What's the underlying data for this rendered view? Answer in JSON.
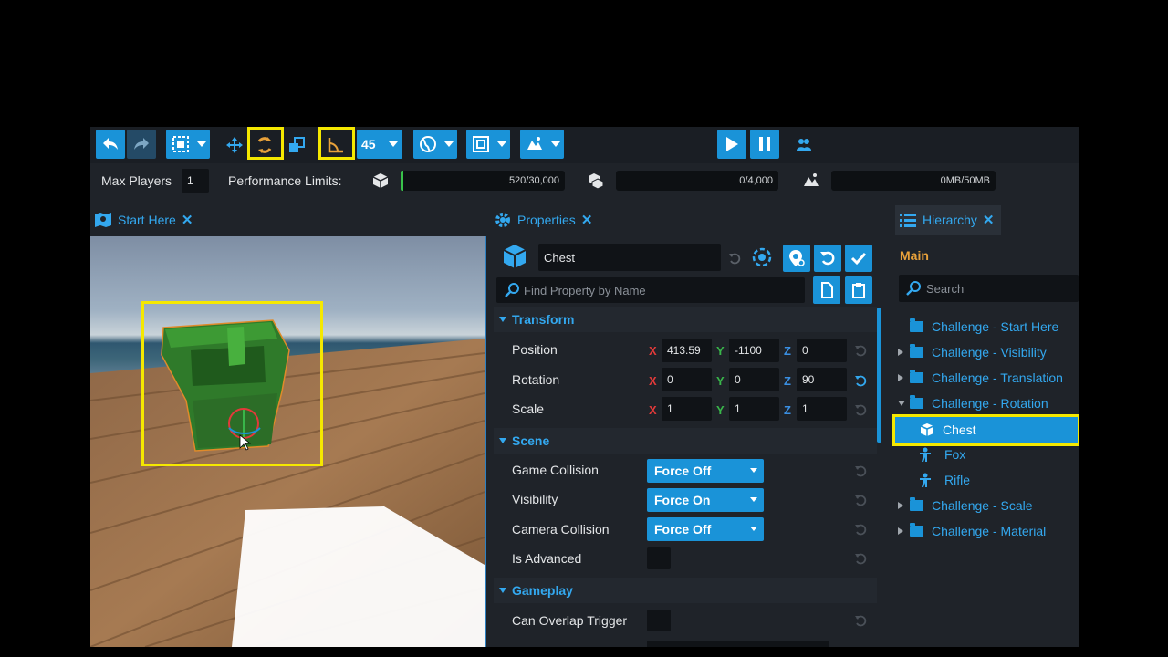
{
  "toolbar": {
    "snap_angle": "45"
  },
  "perf": {
    "max_players_label": "Max Players",
    "max_players_value": "1",
    "limits_label": "Performance Limits:",
    "meter1": "520/30,000",
    "meter2": "0/4,000",
    "meter3": "0MB/50MB",
    "meter1_fill_fraction": 0.017
  },
  "viewport_tab": {
    "label": "Start Here"
  },
  "properties": {
    "tab_label": "Properties",
    "object_name": "Chest",
    "search_placeholder": "Find Property by Name",
    "transform": {
      "title": "Transform",
      "position_label": "Position",
      "rotation_label": "Rotation",
      "scale_label": "Scale",
      "position": {
        "x": "413.59",
        "y": "-1100",
        "z": "0"
      },
      "rotation": {
        "x": "0",
        "y": "0",
        "z": "90"
      },
      "scale": {
        "x": "1",
        "y": "1",
        "z": "1"
      },
      "axis": {
        "x": "X",
        "y": "Y",
        "z": "Z"
      }
    },
    "scene": {
      "title": "Scene",
      "game_collision_label": "Game Collision",
      "game_collision_value": "Force Off",
      "visibility_label": "Visibility",
      "visibility_value": "Force On",
      "camera_collision_label": "Camera Collision",
      "camera_collision_value": "Force Off",
      "is_advanced_label": "Is Advanced"
    },
    "gameplay": {
      "title": "Gameplay",
      "can_overlap_label": "Can Overlap Trigger"
    }
  },
  "hierarchy": {
    "tab_label": "Hierarchy",
    "root_label": "Main",
    "search_placeholder": "Search",
    "items": [
      {
        "label": "Challenge - Start Here"
      },
      {
        "label": "Challenge - Visibility"
      },
      {
        "label": "Challenge - Translation"
      },
      {
        "label": "Challenge - Rotation"
      },
      {
        "label": "Chest"
      },
      {
        "label": "Fox"
      },
      {
        "label": "Rifle"
      },
      {
        "label": "Challenge - Scale"
      },
      {
        "label": "Challenge - Material"
      }
    ]
  },
  "colors": {
    "accent": "#1a93d8",
    "highlight": "#f5e800",
    "root_label": "#e8a13a"
  }
}
